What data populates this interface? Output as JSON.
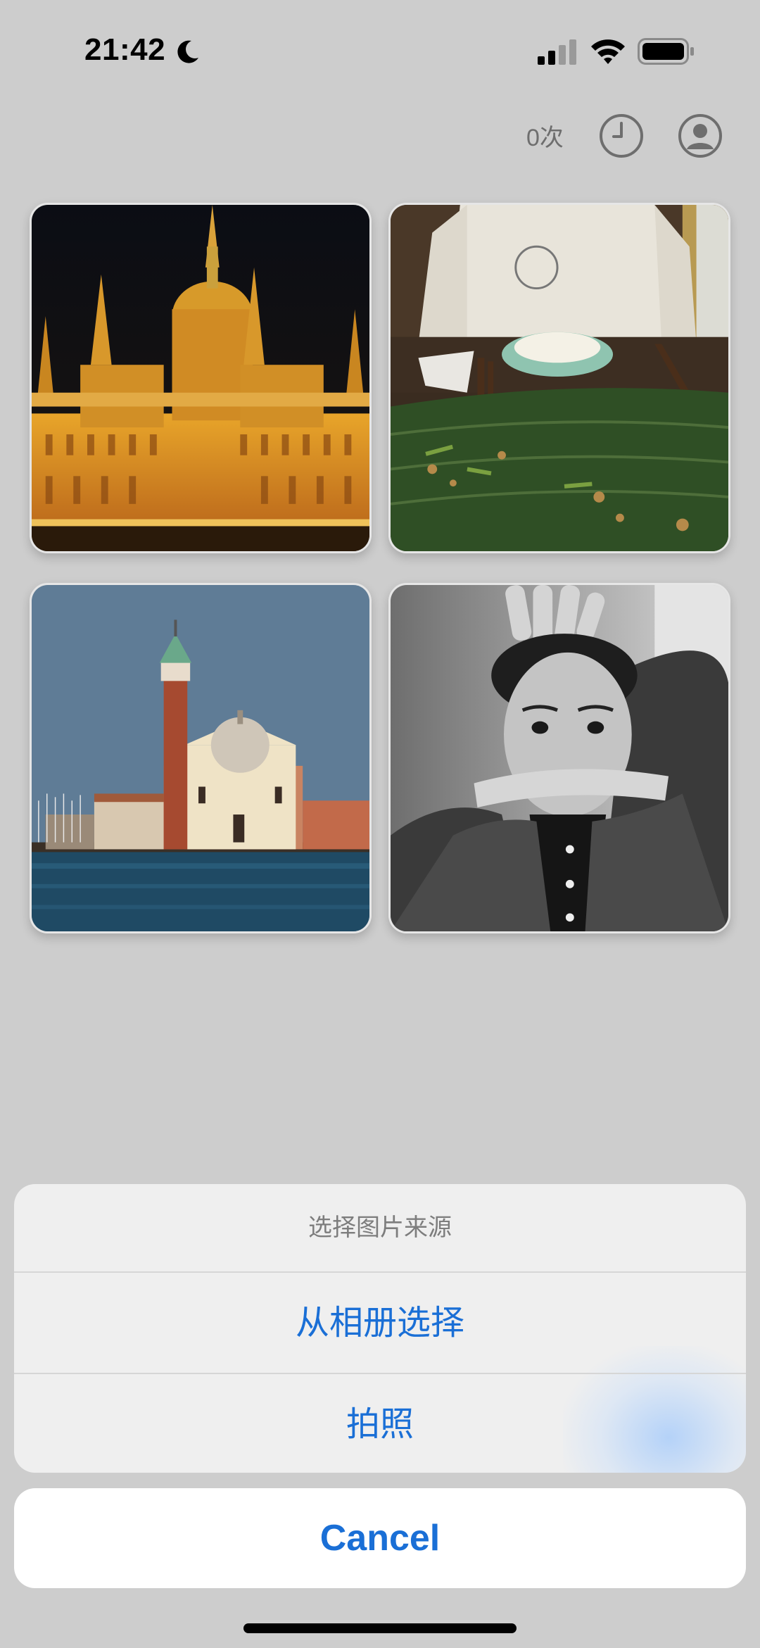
{
  "status_bar": {
    "time": "21:42",
    "icons": [
      "moon-icon",
      "signal-icon",
      "wifi-icon",
      "battery-icon"
    ]
  },
  "top_bar": {
    "usage_count": "0次",
    "icons": [
      "clock-icon",
      "user-icon"
    ]
  },
  "grid": {
    "tiles": [
      {
        "name": "parliament-night-photo"
      },
      {
        "name": "dinner-table-photo"
      },
      {
        "name": "venice-church-photo"
      },
      {
        "name": "black-white-portrait-photo"
      }
    ]
  },
  "action_sheet": {
    "title": "选择图片来源",
    "options": [
      {
        "label": "从相册选择"
      },
      {
        "label": "拍照"
      }
    ],
    "cancel_label": "Cancel",
    "accent_color": "#1a6fd6"
  }
}
